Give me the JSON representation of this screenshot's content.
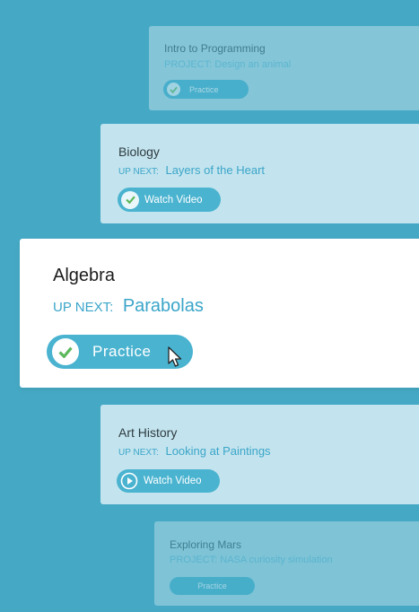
{
  "colors": {
    "background": "#45a9c5",
    "accent": "#3ba5c9",
    "button": "#4ab3d0",
    "check": "#5cb85c"
  },
  "courses": [
    {
      "title": "Intro to Programming",
      "next_label": "PROJECT:",
      "next_title": "Design an animal",
      "action": "Practice",
      "icon": "check-icon"
    },
    {
      "title": "Biology",
      "next_label": "UP NEXT:",
      "next_title": "Layers of the Heart",
      "action": "Watch Video",
      "icon": "check-icon"
    },
    {
      "title": "Algebra",
      "next_label": "UP NEXT:",
      "next_title": "Parabolas",
      "action": "Practice",
      "icon": "check-icon"
    },
    {
      "title": "Art History",
      "next_label": "UP NEXT:",
      "next_title": "Looking at Paintings",
      "action": "Watch Video",
      "icon": "play-icon"
    },
    {
      "title": "Exploring Mars",
      "next_label": "PROJECT:",
      "next_title": "NASA curiosity simulation",
      "action": "Practice",
      "icon": ""
    }
  ]
}
